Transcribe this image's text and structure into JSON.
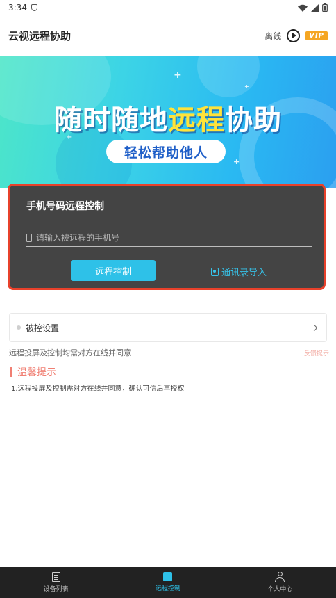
{
  "status_bar": {
    "time": "3:34",
    "icons": [
      "shield-icon",
      "wifi-icon",
      "signal-icon",
      "battery-icon"
    ]
  },
  "header": {
    "title": "云视远程协助",
    "status": "离线",
    "play_icon": "play-circle-icon",
    "vip_label": "VIP"
  },
  "banner": {
    "title_part1": "随时随地",
    "title_highlight": "远程",
    "title_part2": "协助",
    "subtitle": "轻松帮助他人",
    "highlight_color": "#ffe33a"
  },
  "control_card": {
    "title": "手机号码远程控制",
    "phone_placeholder": "请输入被远程的手机号",
    "phone_value": "",
    "remote_button": "远程控制",
    "import_link": "通讯录导入",
    "border_color": "#e8412b",
    "accent_color": "#2ec1e8"
  },
  "settings": {
    "label": "被控设置"
  },
  "consent": {
    "text": "远程投屏及控制均需对方在线并同意",
    "feedback": "反馈提示"
  },
  "tips": {
    "title": "温馨提示",
    "line1": "1.远程投屏及控制需对方在线并同意，确认可信后再授权"
  },
  "bottom_nav": {
    "items": [
      {
        "label": "设备列表",
        "icon": "device-list-icon",
        "active": false
      },
      {
        "label": "远程控制",
        "icon": "remote-control-icon",
        "active": true
      },
      {
        "label": "个人中心",
        "icon": "user-icon",
        "active": false
      }
    ]
  }
}
